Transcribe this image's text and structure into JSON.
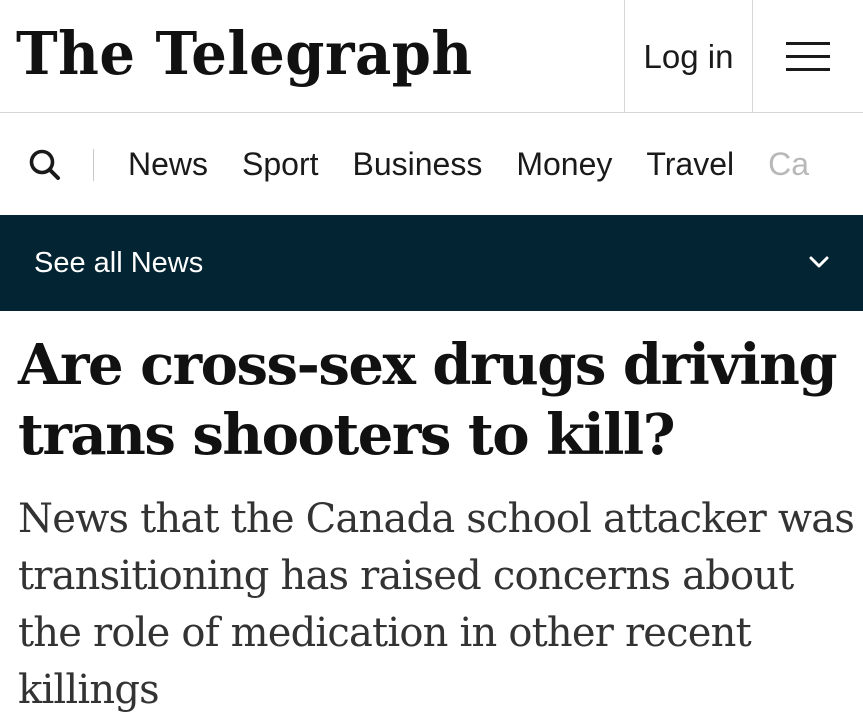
{
  "header": {
    "masthead": "The Telegraph",
    "login_label": "Log in",
    "menu_icon": "hamburger-menu-icon",
    "search_icon": "search-icon"
  },
  "nav": {
    "items": [
      {
        "label": "News"
      },
      {
        "label": "Sport"
      },
      {
        "label": "Business"
      },
      {
        "label": "Money"
      },
      {
        "label": "Travel"
      },
      {
        "label": "Ca"
      }
    ]
  },
  "see_all": {
    "label": "See all News",
    "icon": "chevron-down-icon"
  },
  "article": {
    "headline": "Are cross-sex drugs driving trans shooters to kill?",
    "standfirst": "News that the Canada school attacker was transitioning has raised concerns about the role of medication in other recent killings"
  },
  "colors": {
    "section_bar_bg": "#022433",
    "text": "#111111",
    "divider": "#d6d6d6"
  }
}
